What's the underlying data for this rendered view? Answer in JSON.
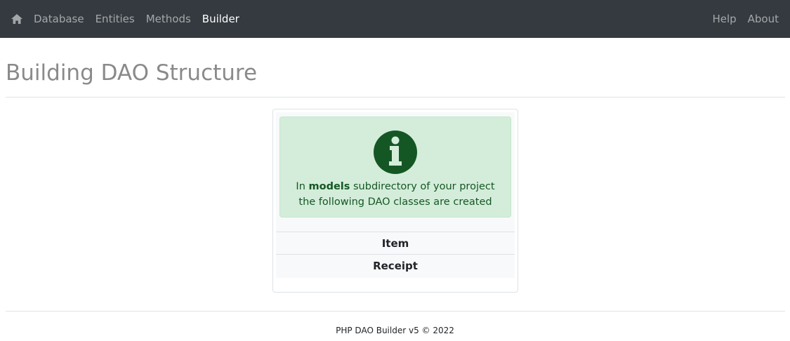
{
  "navbar": {
    "home_icon": "home-icon",
    "left_items": [
      {
        "label": "Database",
        "active": false
      },
      {
        "label": "Entities",
        "active": false
      },
      {
        "label": "Methods",
        "active": false
      },
      {
        "label": "Builder",
        "active": true
      }
    ],
    "right_items": [
      {
        "label": "Help"
      },
      {
        "label": "About"
      }
    ]
  },
  "page": {
    "title": "Building DAO Structure"
  },
  "alert": {
    "icon": "info-circle-icon",
    "text_prefix": "In ",
    "text_bold": "models",
    "text_suffix": " subdirectory of your project",
    "text_line2": "the following DAO classes are created"
  },
  "classes": [
    "Item",
    "Receipt"
  ],
  "footer": {
    "text": "PHP DAO Builder v5 © 2022"
  },
  "colors": {
    "navbar_bg": "#343a40",
    "alert_bg": "#d4edda",
    "alert_text": "#155724",
    "icon_fill": "#155724"
  }
}
